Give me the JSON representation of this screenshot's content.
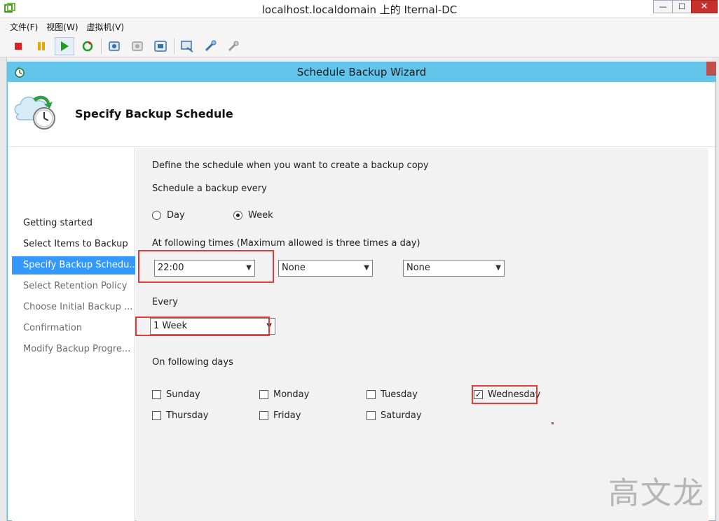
{
  "host": {
    "title": "localhost.localdomain 上的 Iternal-DC",
    "menu": [
      "文件(F)",
      "视图(W)",
      "虚拟机(V)"
    ],
    "win_buttons": {
      "minimize": "—",
      "maximize": "☐",
      "close": "✕"
    }
  },
  "toolbar": {
    "icons": [
      "stop-icon",
      "pause-icon",
      "play-icon",
      "reset-icon",
      "snapshot-icon",
      "revert-snapshot-icon",
      "manage-snapshot-icon",
      "console-icon",
      "settings-icon",
      "tools-icon"
    ],
    "colors": {
      "stop": "#e02020",
      "pause": "#e8a400",
      "play": "#1aa01a"
    }
  },
  "wizard": {
    "title": "Schedule Backup Wizard",
    "header_title": "Specify Backup Schedule",
    "steps": [
      {
        "label": "Getting started",
        "state": "done"
      },
      {
        "label": "Select Items to Backup",
        "state": "done"
      },
      {
        "label": "Specify Backup Schedu...",
        "state": "current"
      },
      {
        "label": "Select Retention Policy",
        "state": "future"
      },
      {
        "label": "Choose Initial Backup ...",
        "state": "future"
      },
      {
        "label": "Confirmation",
        "state": "future"
      },
      {
        "label": "Modify Backup Progre...",
        "state": "future"
      }
    ],
    "content": {
      "intro": "Define the schedule when you want to create a backup copy",
      "schedule_label": "Schedule a backup every",
      "frequency_options": [
        {
          "label": "Day",
          "selected": false
        },
        {
          "label": "Week",
          "selected": true
        }
      ],
      "times_label": "At following times (Maximum allowed is three times a day)",
      "times": [
        "22:00",
        "None",
        "None"
      ],
      "every_label": "Every",
      "every_value": "1 Week",
      "days_label": "On following days",
      "days": [
        {
          "label": "Sunday",
          "checked": false
        },
        {
          "label": "Monday",
          "checked": false
        },
        {
          "label": "Tuesday",
          "checked": false
        },
        {
          "label": "Wednesday",
          "checked": true
        },
        {
          "label": "Thursday",
          "checked": false
        },
        {
          "label": "Friday",
          "checked": false
        },
        {
          "label": "Saturday",
          "checked": false
        }
      ]
    },
    "colors": {
      "title_bar": "#63c5ea",
      "current_step": "#3399ff",
      "highlight": "#e33b3b"
    }
  },
  "watermark": "高文龙"
}
